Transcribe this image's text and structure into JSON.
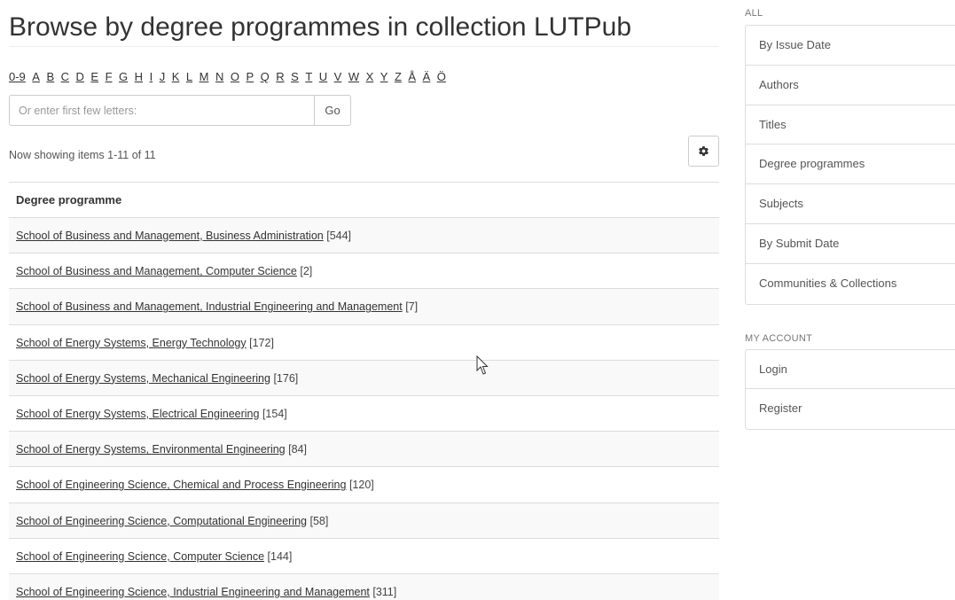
{
  "page": {
    "title": "Browse by degree programmes in collection LUTPub"
  },
  "alphabet": [
    "0-9",
    "A",
    "B",
    "C",
    "D",
    "E",
    "F",
    "G",
    "H",
    "I",
    "J",
    "K",
    "L",
    "M",
    "N",
    "O",
    "P",
    "Q",
    "R",
    "S",
    "T",
    "U",
    "V",
    "W",
    "X",
    "Y",
    "Z",
    "Å",
    "Ä",
    "Ö"
  ],
  "starts_with": {
    "placeholder": "Or enter first few letters:",
    "value": "",
    "go_label": "Go"
  },
  "results": {
    "count_text": "Now showing items 1-11 of 11",
    "settings_icon": "gear-icon"
  },
  "table": {
    "header": "Degree programme",
    "rows": [
      {
        "label": "School of Business and Management, Business Administration",
        "count": "[544]"
      },
      {
        "label": "School of Business and Management, Computer Science",
        "count": "[2]"
      },
      {
        "label": "School of Business and Management, Industrial Engineering and Management",
        "count": "[7]"
      },
      {
        "label": "School of Energy Systems, Energy Technology",
        "count": "[172]"
      },
      {
        "label": "School of Energy Systems, Mechanical Engineering",
        "count": "[176]"
      },
      {
        "label": "School of Energy Systems, Electrical Engineering",
        "count": "[154]"
      },
      {
        "label": "School of Energy Systems, Environmental Engineering",
        "count": "[84]"
      },
      {
        "label": "School of Engineering Science, Chemical and Process Engineering",
        "count": "[120]"
      },
      {
        "label": "School of Engineering Science, Computational Engineering",
        "count": "[58]"
      },
      {
        "label": "School of Engineering Science, Computer Science",
        "count": "[144]"
      },
      {
        "label": "School of Engineering Science, Industrial Engineering and Management",
        "count": "[311]"
      }
    ]
  },
  "sidebar": {
    "all_heading": "ALL",
    "browse_items": [
      "By Issue Date",
      "Authors",
      "Titles",
      "Degree programmes",
      "Subjects",
      "By Submit Date",
      "Communities & Collections"
    ],
    "account_heading": "MY ACCOUNT",
    "account_items": [
      "Login",
      "Register"
    ]
  },
  "colors": {
    "text": "#333333",
    "border": "#dddddd",
    "stripe": "#f9f9f9"
  }
}
